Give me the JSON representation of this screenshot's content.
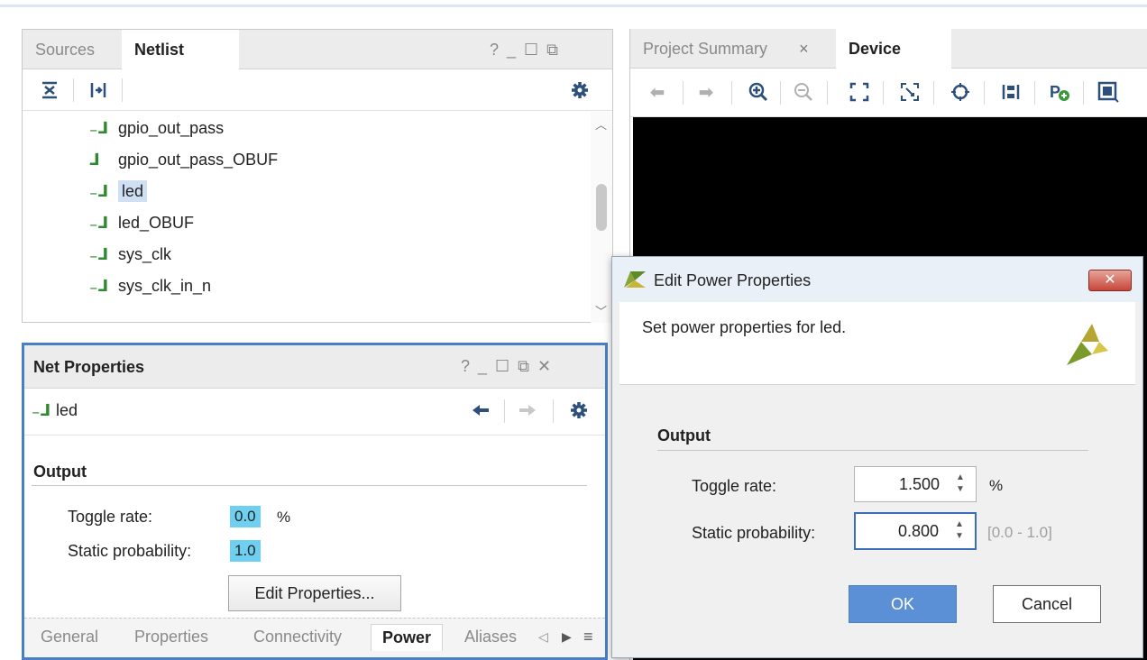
{
  "netlist_panel": {
    "tabs": [
      {
        "label": "Sources",
        "active": false
      },
      {
        "label": "Netlist",
        "active": true
      }
    ],
    "tab_close": "×",
    "window_controls": "? _ ☐ ⧉",
    "tree_items": [
      {
        "label": "gpio_out_pass",
        "selected": false
      },
      {
        "label": "gpio_out_pass_OBUF",
        "selected": false
      },
      {
        "label": "led",
        "selected": true
      },
      {
        "label": "led_OBUF",
        "selected": false
      },
      {
        "label": "sys_clk",
        "selected": false
      },
      {
        "label": "sys_clk_in_n",
        "selected": false
      }
    ]
  },
  "net_properties": {
    "title": "Net Properties",
    "window_controls": "? _ ☐ ⧉ ✕",
    "net_name": "led",
    "section": "Output",
    "toggle_rate_label": "Toggle rate:",
    "toggle_rate_value": "0.0",
    "toggle_rate_unit": "%",
    "static_prob_label": "Static probability:",
    "static_prob_value": "1.0",
    "edit_button": "Edit Properties...",
    "bottom_tabs": [
      {
        "label": "General",
        "active": false
      },
      {
        "label": "Properties",
        "active": false
      },
      {
        "label": "Connectivity",
        "active": false
      },
      {
        "label": "Power",
        "active": true
      },
      {
        "label": "Aliases",
        "active": false
      }
    ]
  },
  "device_panel": {
    "tabs": [
      {
        "label": "Project Summary",
        "active": false
      },
      {
        "label": "Device",
        "active": true
      }
    ]
  },
  "dialog": {
    "title": "Edit Power Properties",
    "close_label": "✕",
    "message": "Set power properties for led.",
    "section": "Output",
    "toggle_rate_label": "Toggle rate:",
    "toggle_rate_value": "1.500",
    "toggle_rate_unit": "%",
    "static_prob_label": "Static probability:",
    "static_prob_value": "0.800",
    "static_prob_range": "[0.0 - 1.0]",
    "ok_label": "OK",
    "cancel_label": "Cancel"
  },
  "colors": {
    "accent_blue": "#4a7fc4",
    "value_highlight": "#6fcff0",
    "ok_button": "#5b8fd6",
    "net_icon": "#2d8a2d"
  }
}
